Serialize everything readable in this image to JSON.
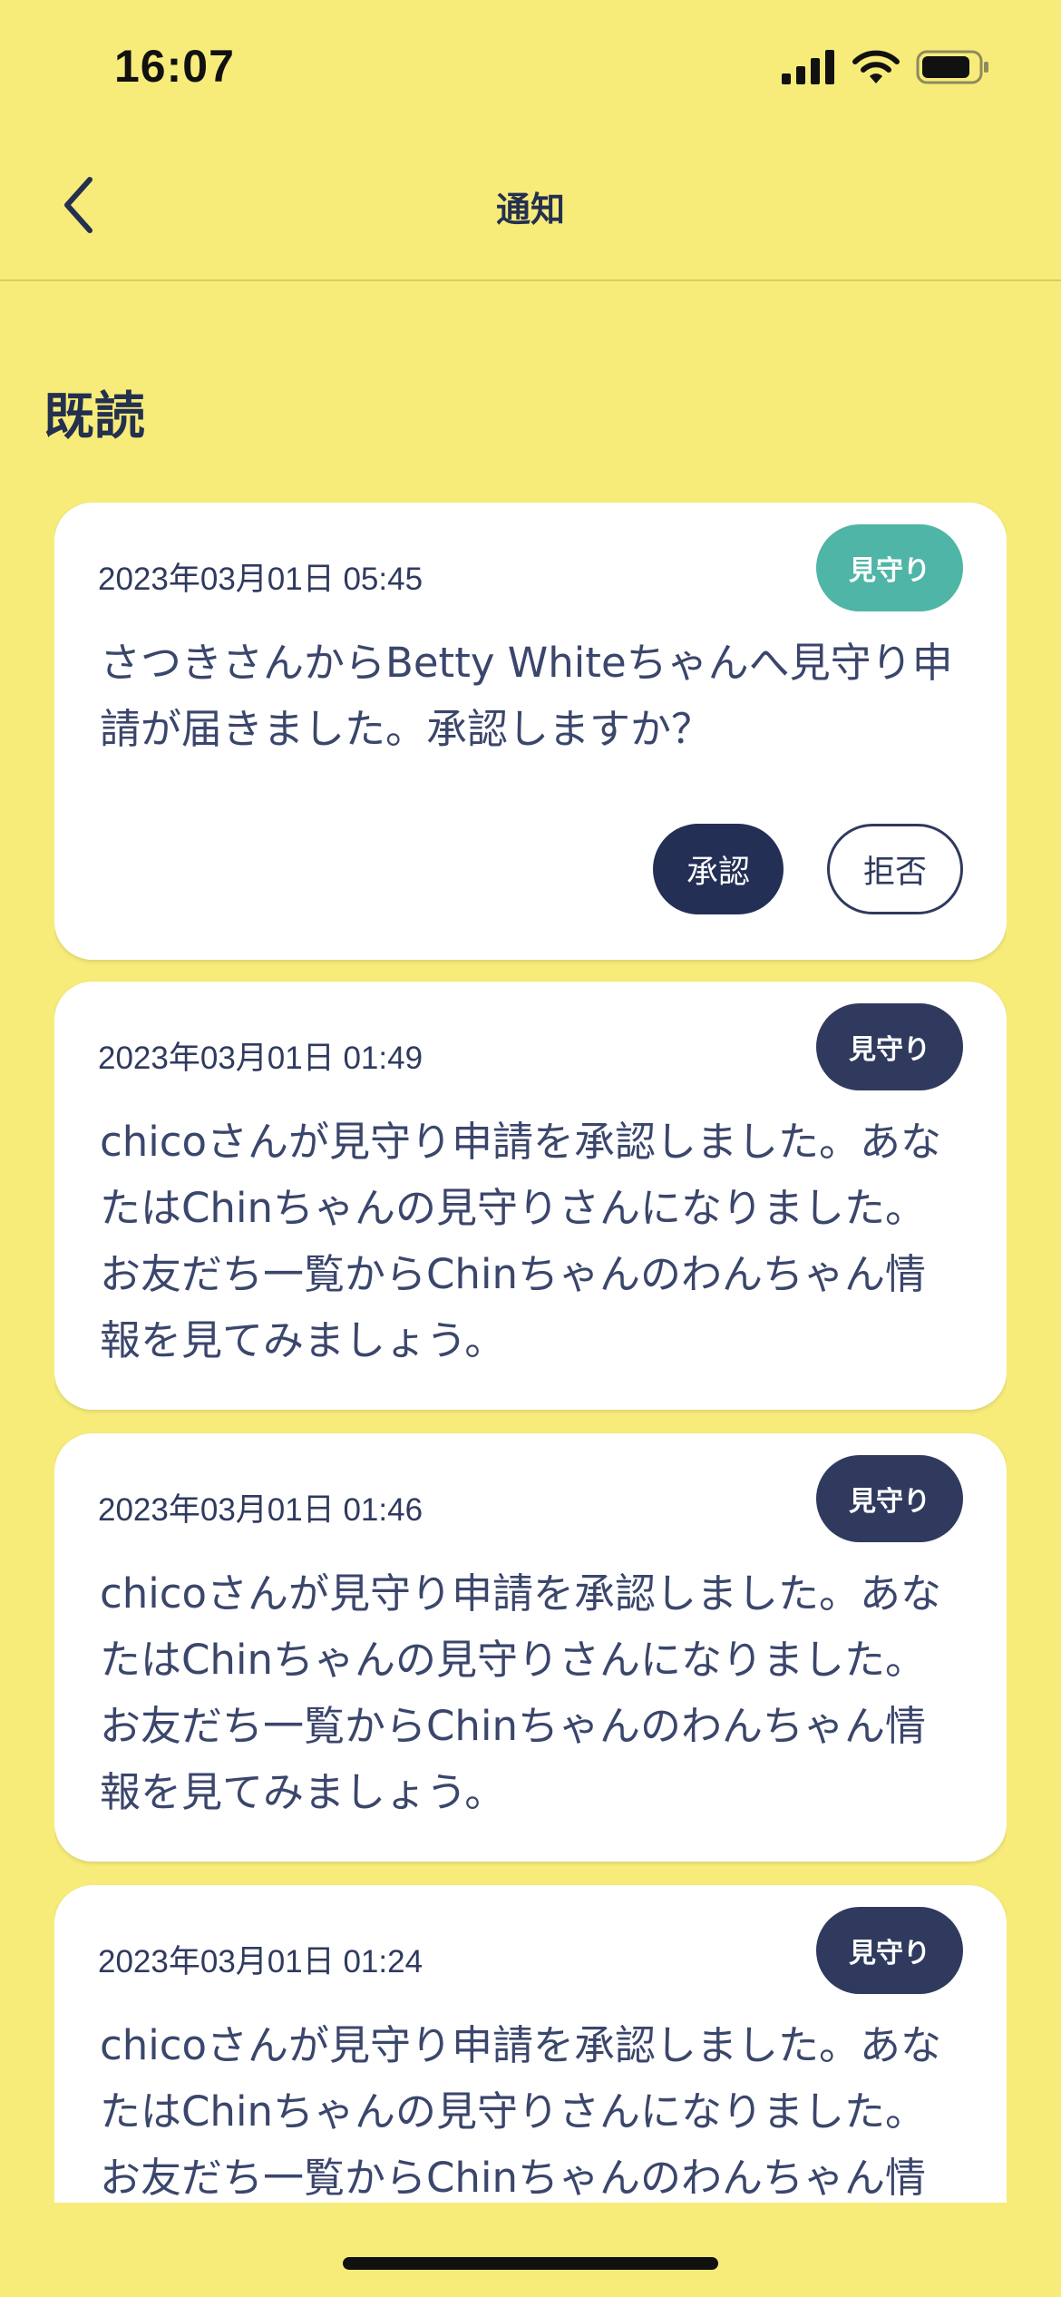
{
  "status_bar": {
    "time": "16:07"
  },
  "header": {
    "title": "通知",
    "back_icon": "chevron-left-icon"
  },
  "section": {
    "title": "既読"
  },
  "colors": {
    "background": "#F7EC7A",
    "tag_teal": "#4FB5A6",
    "tag_navy": "#2F3A5E",
    "approve": "#232F55"
  },
  "notifications": [
    {
      "date": "2023年03月01日 05:45",
      "tag": "見守り",
      "tag_color": "#4FB5A6",
      "message": "さつきさんからBetty Whiteちゃんへ見守り申請が届きました。承認しますか？",
      "approve_label": "承認",
      "reject_label": "拒否"
    },
    {
      "date": "2023年03月01日 01:49",
      "tag": "見守り",
      "tag_color": "#2F3A5E",
      "message": "chicoさんが見守り申請を承認しました。あなたはChinちゃんの見守りさんになりました。お友だち一覧からChinちゃんのわんちゃん情報を見てみましょう。"
    },
    {
      "date": "2023年03月01日 01:46",
      "tag": "見守り",
      "tag_color": "#2F3A5E",
      "message": "chicoさんが見守り申請を承認しました。あなたはChinちゃんの見守りさんになりました。お友だち一覧からChinちゃんのわんちゃん情報を見てみましょう。"
    },
    {
      "date": "2023年03月01日 01:24",
      "tag": "見守り",
      "tag_color": "#2F3A5E",
      "message": "chicoさんが見守り申請を承認しました。あなたはChinちゃんの見守りさんになりました。お友だち一覧からChinちゃんのわんちゃん情報を見てみましょう。"
    }
  ]
}
